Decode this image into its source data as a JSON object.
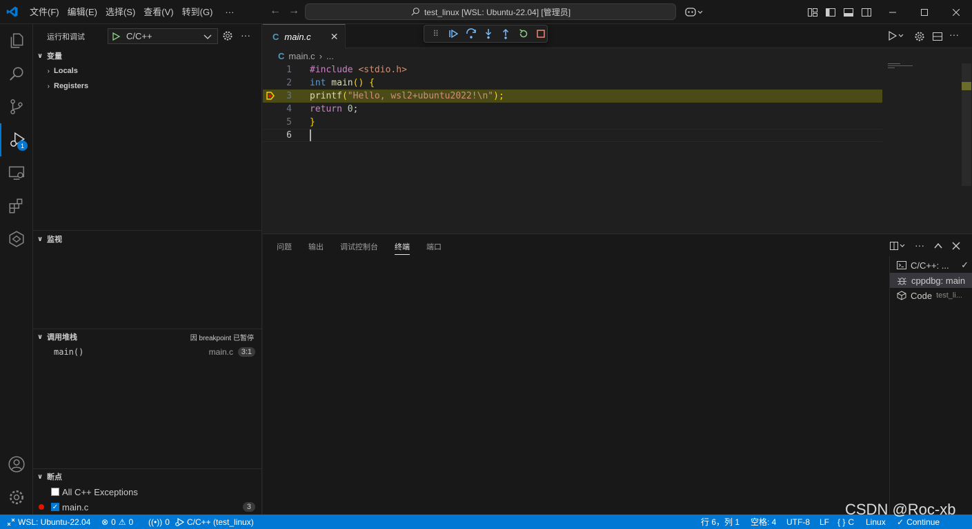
{
  "titlebar": {
    "menus": [
      "文件(F)",
      "编辑(E)",
      "选择(S)",
      "查看(V)",
      "转到(G)",
      "···"
    ],
    "command_center": "test_linux [WSL: Ubuntu-22.04] [管理员]"
  },
  "activity": {
    "debug_badge": "1"
  },
  "sidebar": {
    "title": "运行和调试",
    "config": "C/C++",
    "variables": {
      "title": "变量",
      "items": [
        "Locals",
        "Registers"
      ]
    },
    "watch": {
      "title": "监视"
    },
    "callstack": {
      "title": "调用堆栈",
      "status": "因 breakpoint 已暂停",
      "frame": "main()",
      "file": "main.c",
      "pos": "3:1"
    },
    "breakpoints": {
      "title": "断点",
      "items": [
        {
          "label": "All C++ Exceptions",
          "checked": false
        },
        {
          "label": "main.c",
          "checked": true,
          "count": "3"
        }
      ]
    }
  },
  "editor": {
    "tab": "main.c",
    "breadcrumb": [
      "main.c",
      "..."
    ],
    "lines": [
      {
        "n": "1"
      },
      {
        "n": "2"
      },
      {
        "n": "3"
      },
      {
        "n": "4"
      },
      {
        "n": "5"
      },
      {
        "n": "6"
      }
    ],
    "code": {
      "l1a": "#include",
      "l1b": " <stdio.h>",
      "l2a": "int",
      "l2b": " main",
      "l2c": "() {",
      "l3a": "printf",
      "l3b": "(",
      "l3c": "\"Hello, wsl2+ubuntu2022!\\n\"",
      "l3d": ");",
      "l4a": "return",
      "l4b": " 0",
      "l4c": ";",
      "l5a": "}"
    }
  },
  "panel": {
    "tabs": [
      "问题",
      "输出",
      "调试控制台",
      "终端",
      "端口"
    ],
    "terminals": [
      {
        "label": "C/C++: ...",
        "sub": ""
      },
      {
        "label": "cppdbg: main",
        "sub": ""
      },
      {
        "label": "Code",
        "sub": "test_li..."
      }
    ]
  },
  "statusbar": {
    "remote": "WSL: Ubuntu-22.04",
    "errors": "0",
    "warnings": "0",
    "ports": "0",
    "debug": "C/C++ (test_linux)",
    "position": "行 6，列 1",
    "spaces": "空格: 4",
    "encoding": "UTF-8",
    "eol": "LF",
    "language": "C",
    "platform": "Linux",
    "continue": "Continue"
  },
  "watermark": "CSDN @Roc-xb",
  "colors": {
    "accent": "#0078d4",
    "debug_line": "#4b4b18",
    "breakpoint": "#e51400"
  }
}
